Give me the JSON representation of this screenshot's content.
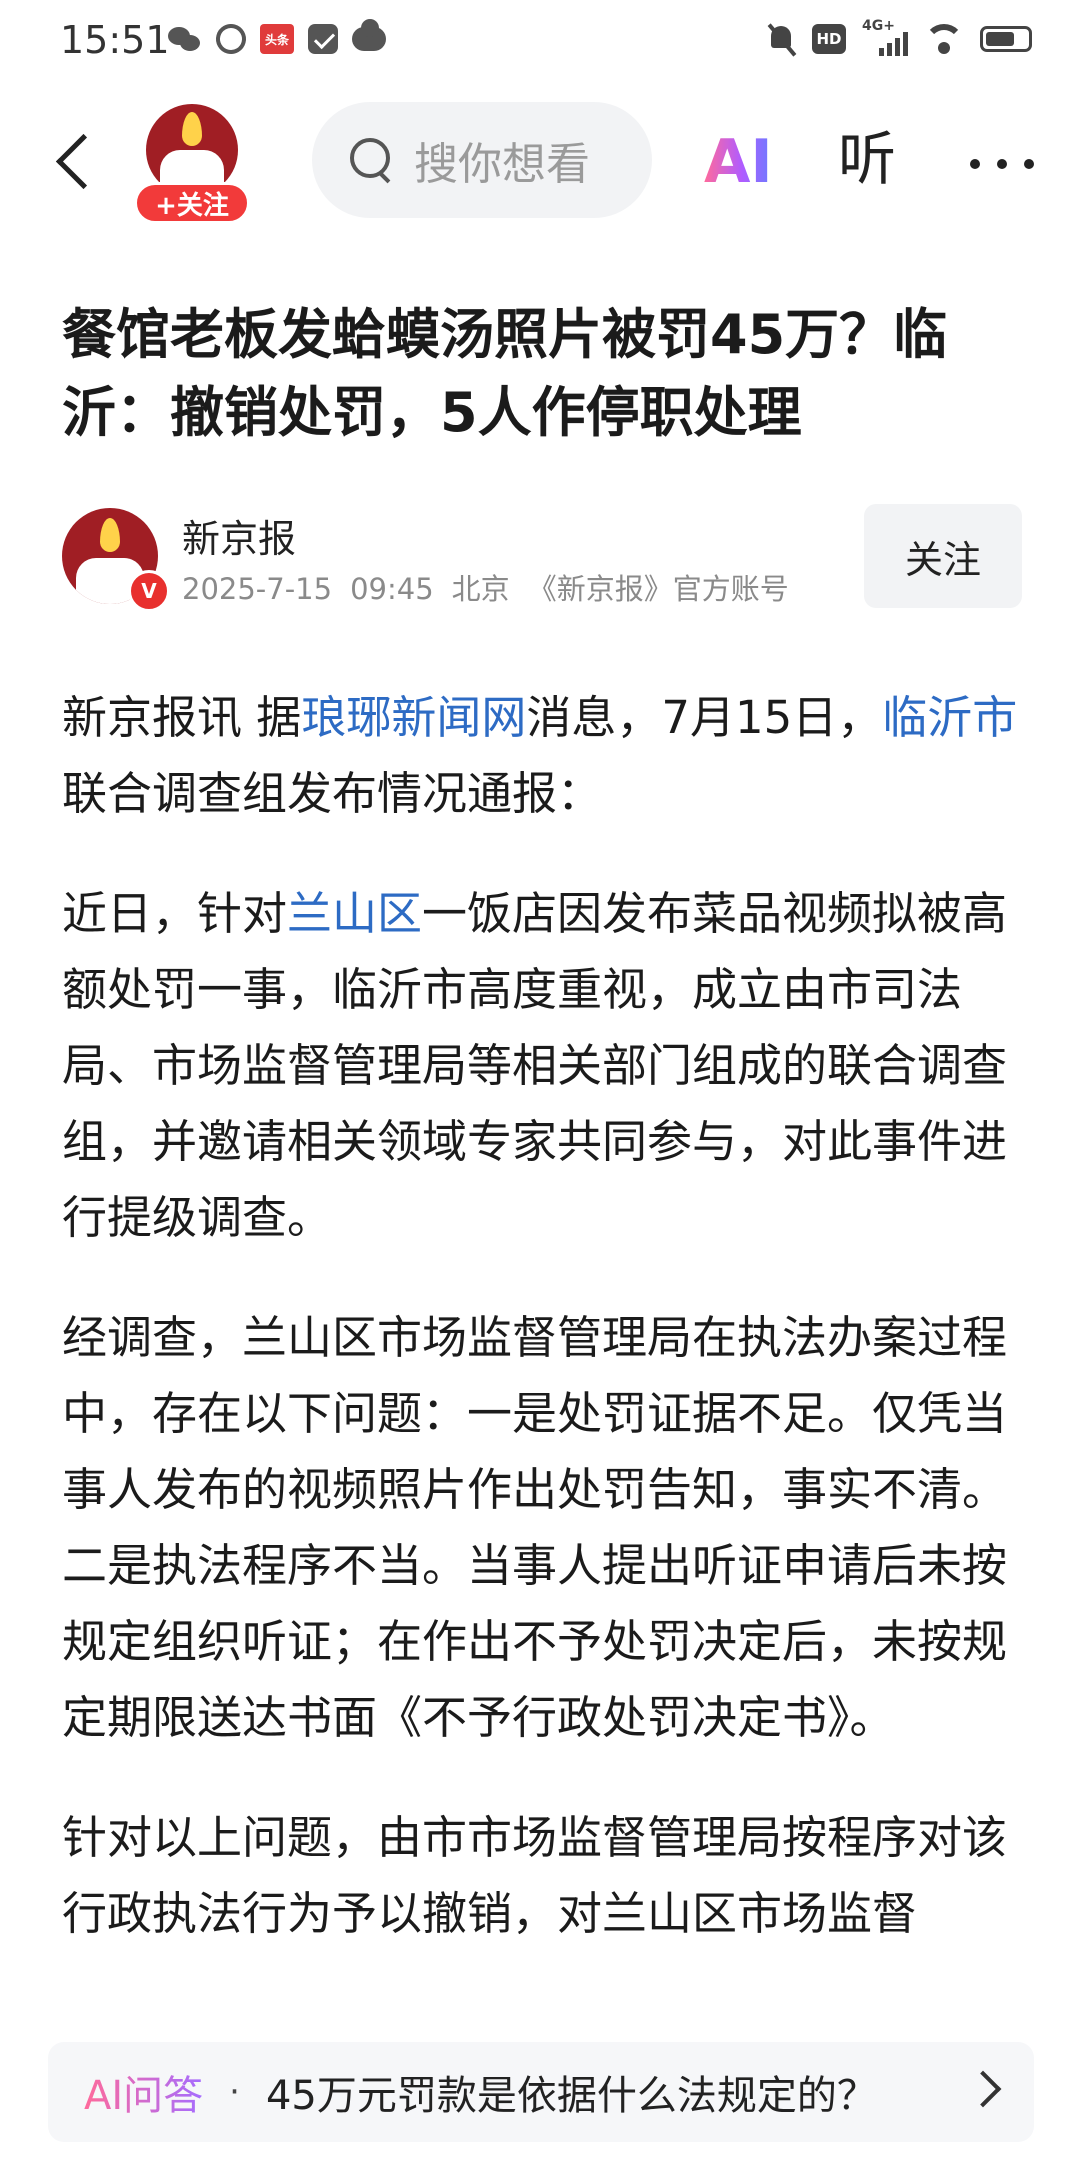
{
  "status_bar": {
    "time": "15:51",
    "toutiao_icon_text": "头条",
    "hd_label": "HD",
    "network_label": "4G+"
  },
  "nav": {
    "follow_badge": "+关注",
    "search_placeholder": "搜你想看",
    "ai_label": "AI",
    "listen_label": "听"
  },
  "article": {
    "title": "餐馆老板发蛤蟆汤照片被罚45万？临沂：撤销处罚，5人作停职处理",
    "author": {
      "name": "新京报",
      "date": "2025-7-15",
      "time": "09:45",
      "location": "北京",
      "account": "《新京报》官方账号",
      "verified_mark": "V",
      "follow_button": "关注"
    },
    "paragraphs": {
      "p1": {
        "t1": "新京报讯 据",
        "link1": "琅琊新闻网",
        "t2": "消息，7月15日，",
        "link2": "临沂市",
        "t3": "联合调查组发布情况通报："
      },
      "p2": {
        "t1": "近日，针对",
        "link1": "兰山区",
        "t2": "一饭店因发布菜品视频拟被高额处罚一事，临沂市高度重视，成立由市司法局、市场监督管理局等相关部门组成的联合调查组，并邀请相关领域专家共同参与，对此事件进行提级调查。"
      },
      "p3": "经调查，兰山区市场监督管理局在执法办案过程中，存在以下问题：一是处罚证据不足。仅凭当事人发布的视频照片作出处罚告知，事实不清。二是执法程序不当。当事人提出听证申请后未按规定组织听证；在作出不予处罚决定后，未按规定期限送达书面《不予行政处罚决定书》。",
      "p4": "针对以上问题，由市市场监督管理局按程序对该行政执法行为予以撤销，对兰山区市场监督"
    }
  },
  "ai_ask": {
    "label": "AI问答",
    "separator": "·",
    "question": "45万元罚款是依据什么法规定的？"
  }
}
